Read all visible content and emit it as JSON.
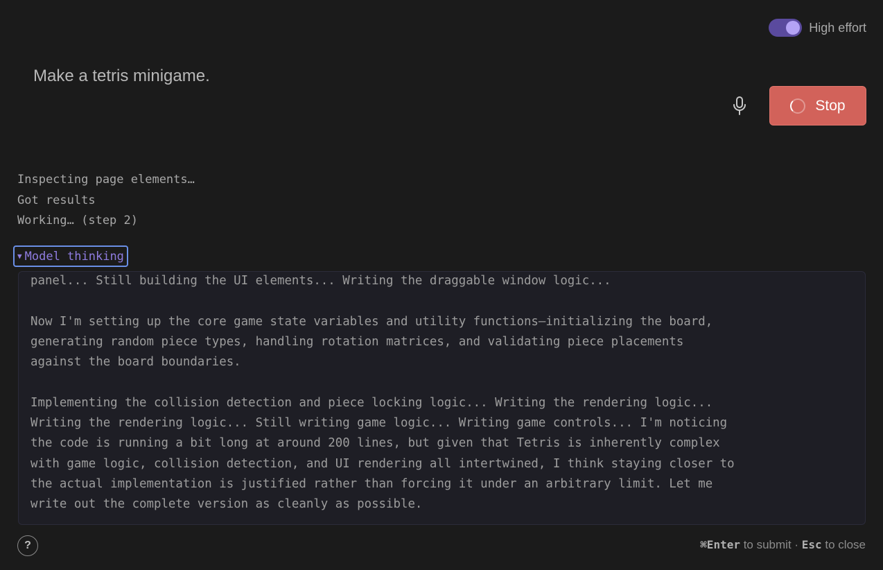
{
  "effort_toggle": {
    "label": "High effort",
    "on": true
  },
  "prompt": {
    "text": "Make a tetris minigame."
  },
  "mic": {
    "icon": "microphone-icon"
  },
  "stop_button": {
    "label": "Stop",
    "icon": "spinner-icon"
  },
  "status_lines": [
    "Inspecting page elements…",
    "Got results",
    "Working… (step 2)"
  ],
  "thinking": {
    "summary_label": "Model thinking",
    "expanded": true,
    "paragraphs": [
      "panel... Still building the UI elements... Writing the draggable window logic...",
      "Now I'm setting up the core game state variables and utility functions—initializing the board,\ngenerating random piece types, handling rotation matrices, and validating piece placements\nagainst the board boundaries.",
      "Implementing the collision detection and piece locking logic... Writing the rendering logic...\nWriting the rendering logic... Still writing game logic... Writing game controls... I'm noticing\nthe code is running a bit long at around 200 lines, but given that Tetris is inherently complex\nwith game logic, collision detection, and UI rendering all intertwined, I think staying closer to\nthe actual implementation is justified rather than forcing it under an arbitrary limit. Let me\nwrite out the complete version as cleanly as possible."
    ]
  },
  "footer": {
    "help_label": "?",
    "submit_key": "⌘Enter",
    "submit_text": " to submit · ",
    "close_key": "Esc",
    "close_text": " to close"
  },
  "colors": {
    "background": "#1b1b1b",
    "stop_button": "#d2625a",
    "toggle_track": "#5a4a9e",
    "toggle_knob": "#b4a3f5",
    "thinking_accent": "#8f7ce0",
    "focus_ring": "#6a8fe6"
  }
}
